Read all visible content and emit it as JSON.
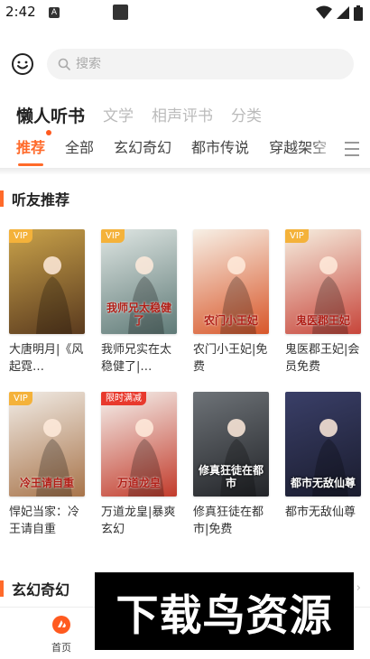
{
  "status_bar": {
    "time": "2:42",
    "app_icon_letter": "A"
  },
  "search": {
    "placeholder": "搜索"
  },
  "top_tabs": [
    {
      "label": "懒人听书",
      "active": true
    },
    {
      "label": "文学",
      "active": false
    },
    {
      "label": "相声评书",
      "active": false
    },
    {
      "label": "分类",
      "active": false
    }
  ],
  "category_tabs": [
    {
      "label": "推荐",
      "active": true
    },
    {
      "label": "全部",
      "active": false
    },
    {
      "label": "玄幻奇幻",
      "active": false
    },
    {
      "label": "都市传说",
      "active": false
    },
    {
      "label": "穿越架空",
      "active": false
    }
  ],
  "section_friends": {
    "title": "听友推荐"
  },
  "books": [
    {
      "title": "大唐明月|《风起霓…",
      "badge": "VIP",
      "badge_color": "#f4b23a",
      "cover_colors": [
        "#c9a24a",
        "#5a3a1e"
      ],
      "cover_icon": "palace-lady-icon"
    },
    {
      "title": "我师兄实在太稳健了|…",
      "badge": "VIP",
      "badge_color": "#f4b23a",
      "cover_colors": [
        "#dfe6e3",
        "#5f7a77"
      ],
      "cover_icon": "swordsman-icon",
      "cover_text": "我师兄太稳健了"
    },
    {
      "title": "农门小王妃|免费",
      "badge": "",
      "badge_color": "",
      "cover_colors": [
        "#f7f0e6",
        "#d8572a"
      ],
      "cover_icon": "lady-red-dress-icon",
      "cover_text": "农门小王妃"
    },
    {
      "title": "鬼医郡王妃|会员免费",
      "badge": "VIP",
      "badge_color": "#f4b23a",
      "cover_colors": [
        "#f6efe0",
        "#c7453a"
      ],
      "cover_icon": "lady-robe-icon",
      "cover_text": "鬼医郡王妃"
    },
    {
      "title": "悍妃当家：冷王请自重",
      "badge": "VIP",
      "badge_color": "#f4b23a",
      "cover_colors": [
        "#f1ece6",
        "#a8744a"
      ],
      "cover_icon": "calligraphy-icon",
      "cover_text": "冷王请自重"
    },
    {
      "title": "万道龙皇|暴爽玄幻",
      "badge": "限时满减",
      "badge_color": "#e8392d",
      "cover_colors": [
        "#f5f3ef",
        "#c23b2b"
      ],
      "cover_icon": "dragon-emperor-icon",
      "cover_text": "万道龙皇"
    },
    {
      "title": "修真狂徒在都市|免费",
      "badge": "",
      "badge_color": "",
      "cover_colors": [
        "#6e7378",
        "#222428"
      ],
      "cover_icon": "city-ruins-icon",
      "cover_text": "修真狂徒在都市"
    },
    {
      "title": "都市无敌仙尊",
      "badge": "",
      "badge_color": "",
      "cover_colors": [
        "#3a3f68",
        "#1a1c2e"
      ],
      "cover_icon": "city-hero-icon",
      "cover_text": "都市无敌仙尊"
    }
  ],
  "section_fantasy": {
    "title": "玄幻奇幻"
  },
  "bottom_nav": {
    "home_label": "首页"
  },
  "watermark": {
    "text": "下载鸟资源"
  },
  "colors": {
    "accent": "#ff6a2a",
    "vip": "#f4b23a",
    "promo": "#e8392d"
  }
}
